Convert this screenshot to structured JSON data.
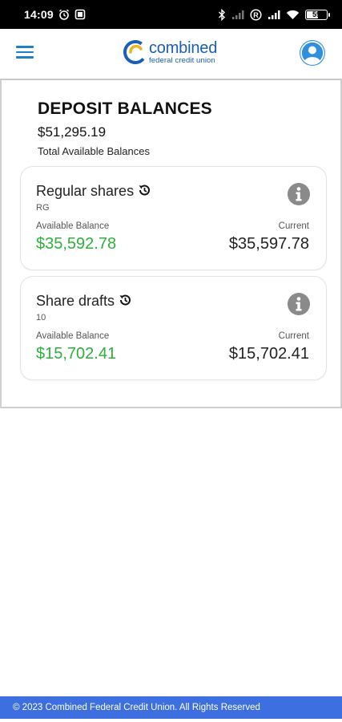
{
  "status_bar": {
    "time": "14:09",
    "battery": "59",
    "battery_fraction": 0.59,
    "icons": [
      "alarm-icon",
      "screenshot-icon",
      "bluetooth-icon",
      "signal-off-icon",
      "r-badge-icon",
      "signal-icon",
      "wifi-icon",
      "battery-icon"
    ]
  },
  "header": {
    "logo_word": "combined",
    "logo_sub": "federal credit union",
    "menu_icon": "hamburger-menu-icon",
    "profile_icon": "user-avatar-icon"
  },
  "deposit": {
    "title": "DEPOSIT BALANCES",
    "total_amount": "$51,295.19",
    "total_label": "Total Available Balances"
  },
  "accounts": [
    {
      "name": "Regular shares",
      "code": "RG",
      "available_label": "Available Balance",
      "available_amount": "$35,592.78",
      "current_label": "Current",
      "current_amount": "$35,597.78"
    },
    {
      "name": "Share drafts",
      "code": "10",
      "available_label": "Available Balance",
      "available_amount": "$15,702.41",
      "current_label": "Current",
      "current_amount": "$15,702.41"
    }
  ],
  "footer": {
    "text": "© 2023 Combined Federal Credit Union. All Rights Reserved"
  },
  "colors": {
    "brand_blue": "#1a5fb4",
    "menu_blue": "#1f7fc9",
    "available_green": "#2eb03a",
    "footer_blue": "#3d6fe0",
    "info_gray": "#8a8a8a"
  }
}
